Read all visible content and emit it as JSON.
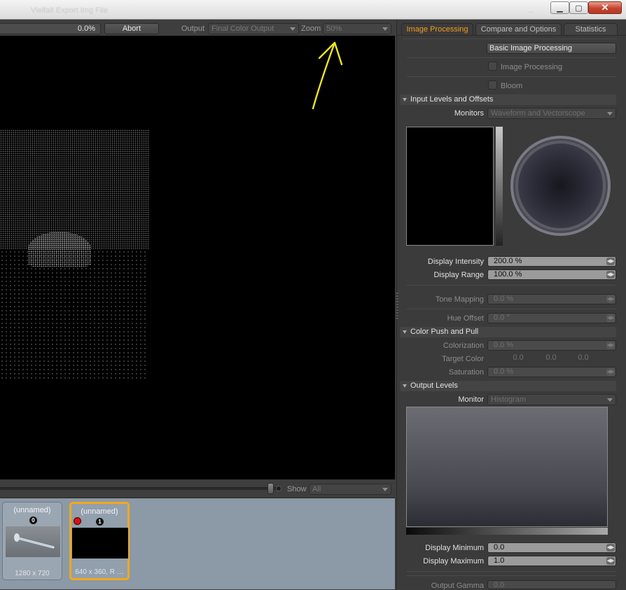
{
  "window": {
    "title": "Vielfalt Export Img File",
    "title_right": "...",
    "buttons": {
      "minimize": "▁",
      "maximize": "▢",
      "close": "✕"
    }
  },
  "toolbar": {
    "progress_text": "0.0%",
    "progress_value": 0.0,
    "abort_label": "Abort",
    "output_label": "Output",
    "output_value": "Final Color Output",
    "zoom_label": "Zoom",
    "zoom_value": "50%"
  },
  "annotation": {
    "color": "#f0e61e",
    "type": "arrow pointing to zoom control"
  },
  "bottom": {
    "show_label": "Show",
    "show_value": "All"
  },
  "thumbnails": [
    {
      "name": "(unnamed)",
      "index": "0",
      "size": "1280 x 720",
      "selected": false
    },
    {
      "name": "(unnamed)",
      "index": "1",
      "size": "640 x 360, R …",
      "selected": true
    }
  ],
  "tabs": [
    {
      "label": "Image Processing",
      "active": true
    },
    {
      "label": "Compare and Options",
      "active": false
    },
    {
      "label": "Statistics",
      "active": false
    }
  ],
  "panel": {
    "preset_button": "Basic Image Processing",
    "image_processing_label": "Image Processing",
    "bloom_label": "Bloom",
    "input_section": "Input Levels and Offsets",
    "monitors_label": "Monitors",
    "monitors_value": "Waveform and Vectorscope",
    "display_intensity_label": "Display Intensity",
    "display_intensity_value": "200.0 %",
    "display_range_label": "Display Range",
    "display_range_value": "100.0 %",
    "tone_mapping_label": "Tone Mapping",
    "tone_mapping_value": "0.0 %",
    "hue_offset_label": "Hue Offset",
    "hue_offset_value": "0.0 °",
    "color_section": "Color Push and Pull",
    "colorization_label": "Colorization",
    "colorization_value": "0.0 %",
    "target_color_label": "Target Color",
    "target_color_values": [
      "0.0",
      "0.0",
      "0.0"
    ],
    "saturation_label": "Saturation",
    "saturation_value": "0.0 %",
    "output_section": "Output Levels",
    "monitor_label": "Monitor",
    "monitor_value": "Histogram",
    "display_minimum_label": "Display Minimum",
    "display_minimum_value": "0.0",
    "display_maximum_label": "Display Maximum",
    "display_maximum_value": "1.0",
    "output_gamma_label": "Output Gamma",
    "output_gamma_value": "0.0"
  },
  "colors": {
    "accent_tab": "#f29a1e",
    "selected_thumb": "#f2a81e",
    "thumb_bg": "#8c99a6",
    "close_button": "#c4432f"
  }
}
